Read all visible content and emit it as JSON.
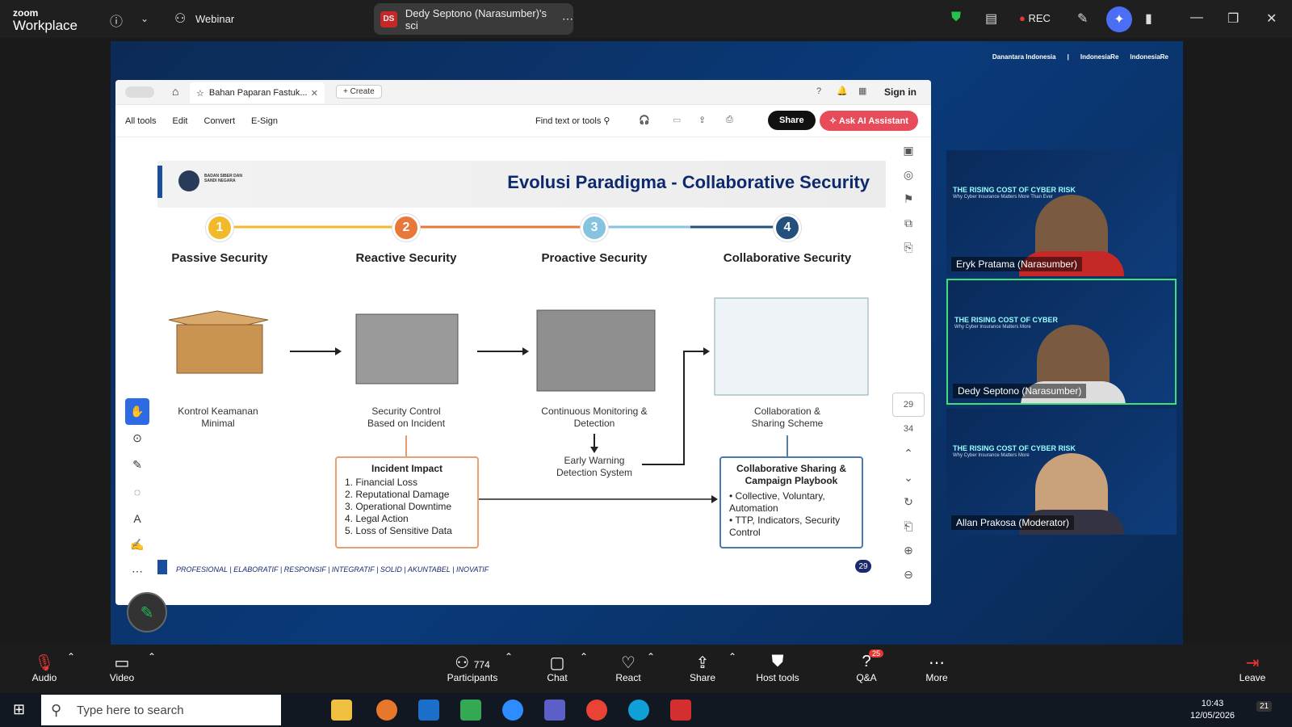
{
  "app": {
    "logo_top": "zoom",
    "logo_bottom": "Workplace",
    "mode": "Webinar",
    "sharing": "Dedy Septono (Narasumber)'s sci",
    "rec": "REC"
  },
  "acrobat": {
    "tab": "Bahan Paparan Fastuk...",
    "create": "+ Create",
    "signin": "Sign in",
    "menu": [
      "All tools",
      "Edit",
      "Convert",
      "E-Sign"
    ],
    "find": "Find text or tools",
    "share": "Share",
    "ai": "Ask AI Assistant",
    "page_current": "29",
    "page_total": "34"
  },
  "slide": {
    "org": "BADAN SIBER DAN SANDI NEGARA",
    "title": "Evolusi Paradigma - Collaborative Security",
    "steps": [
      {
        "num": "1",
        "name": "Passive Security",
        "caption": "Kontrol Keamanan Minimal",
        "color": "#f2b92b"
      },
      {
        "num": "2",
        "name": "Reactive Security",
        "caption": "Security Control Based on Incident",
        "color": "#e8773a"
      },
      {
        "num": "3",
        "name": "Proactive Security",
        "caption": "Continuous Monitoring & Detection",
        "color": "#86c3e0"
      },
      {
        "num": "4",
        "name": "Collaborative Security",
        "caption": "Collaboration & Sharing Scheme",
        "color": "#24507e"
      }
    ],
    "early_warning": "Early Warning Detection System",
    "incident_title": "Incident Impact",
    "incident_items": [
      "1. Financial Loss",
      "2. Reputational Damage",
      "3. Operational Downtime",
      "4. Legal Action",
      "5. Loss of Sensitive Data"
    ],
    "playbook_title": "Collaborative Sharing & Campaign Playbook",
    "playbook_items": [
      "• Collective, Voluntary, Automation",
      "• TTP, Indicators, Security Control"
    ],
    "motto": "PROFESIONAL | ELABORATIF | RESPONSIF | INTEGRATIF | SOLID | AKUNTABEL | INOVATIF",
    "page": "29"
  },
  "videos": [
    {
      "name": "Eryk Pratama (Narasumber)",
      "head": "THE RISING COST OF CYBER RISK",
      "sub": "Why Cyber Insurance Matters More Than Ever"
    },
    {
      "name": "Dedy Septono (Narasumber)",
      "head": "THE RISING COST OF CYBER",
      "sub": "Why Cyber Insurance Matters More"
    },
    {
      "name": "Allan Prakosa (Moderator)",
      "head": "THE RISING COST OF CYBER RISK",
      "sub": "Why Cyber Insurance Matters More"
    }
  ],
  "bottombar": {
    "audio": "Audio",
    "video": "Video",
    "participants": "Participants",
    "participants_count": "774",
    "chat": "Chat",
    "react": "React",
    "share": "Share",
    "host": "Host tools",
    "qa": "Q&A",
    "qa_badge": "25",
    "more": "More",
    "leave": "Leave"
  },
  "taskbar": {
    "search": "Type here to search",
    "time": "10:43",
    "date": "12/05/2026",
    "notif": "21"
  }
}
